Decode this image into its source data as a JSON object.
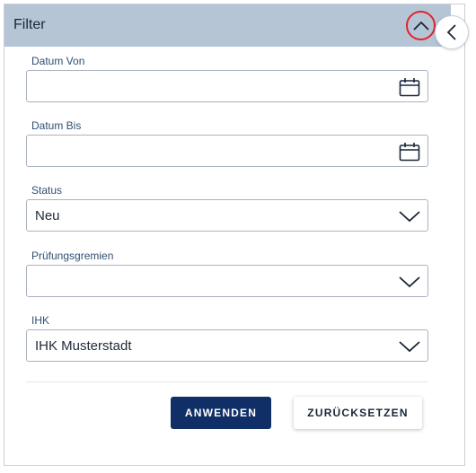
{
  "header": {
    "title": "Filter"
  },
  "fields": {
    "datum_von": {
      "label": "Datum Von",
      "value": ""
    },
    "datum_bis": {
      "label": "Datum Bis",
      "value": ""
    },
    "status": {
      "label": "Status",
      "value": "Neu"
    },
    "pruefungsgremien": {
      "label": "Prüfungsgremien",
      "value": ""
    },
    "ihk": {
      "label": "IHK",
      "value": "IHK Musterstadt"
    }
  },
  "actions": {
    "apply_label": "ANWENDEN",
    "reset_label": "ZURÜCKSETZEN"
  },
  "icons": {
    "collapse": "chevron-up-icon",
    "side_toggle": "chevron-left-icon",
    "date": "calendar-icon",
    "dropdown": "chevron-down-icon"
  },
  "colors": {
    "header_bg": "#b5c5d6",
    "primary": "#0f2f66",
    "label": "#2f4f73",
    "highlight_ring": "#e0242b"
  }
}
